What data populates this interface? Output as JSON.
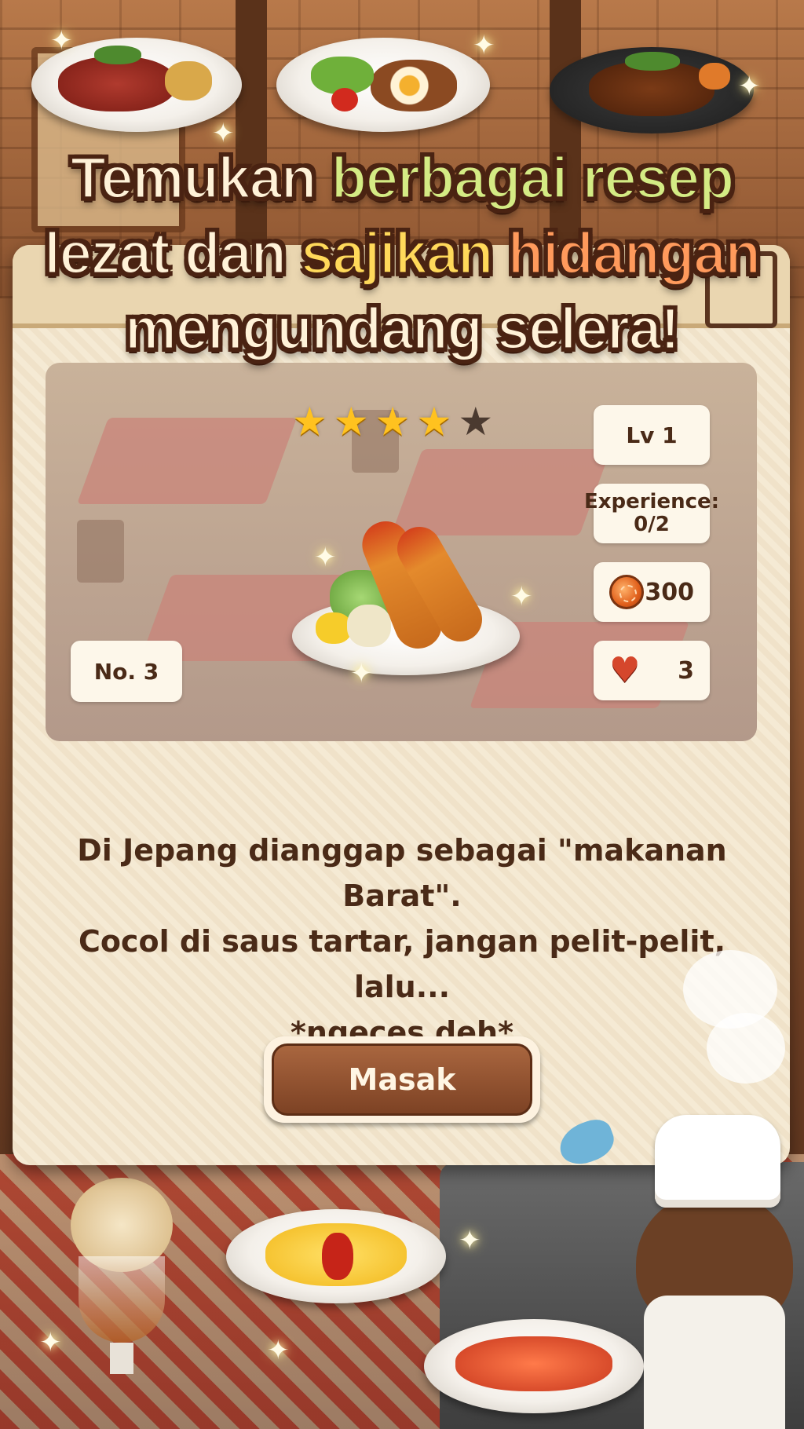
{
  "headline": {
    "line1_a": "Temukan ",
    "line1_b": "berbagai resep",
    "line2_a": "lezat dan  ",
    "line2_b": "sajikan ",
    "line2_c": "hidangan",
    "line3": "mengundang selera!"
  },
  "recipe": {
    "stars_filled": 4,
    "stars_total": 5,
    "level": "Lv 1",
    "experience_label": "Experience:",
    "experience_value": "0/2",
    "coin_value": "300",
    "heart_value": "3",
    "number": "No. 3",
    "description_line1": "Di Jepang dianggap sebagai \"makanan Barat\".",
    "description_line2": "Cocol di saus tartar, jangan pelit-pelit, lalu...",
    "description_line3": "*ngeces deh*",
    "cook_button": "Masak"
  },
  "icons": {
    "star": "star-icon",
    "coin": "coin-icon",
    "heart": "heart-icon"
  },
  "colors": {
    "accent_brown": "#7d4224",
    "star_gold": "#ffc21f",
    "heart_red": "#d5472c",
    "headline_green": "#d4eb84",
    "headline_yellow": "#ffd95a",
    "headline_orange": "#ff9a5c"
  }
}
